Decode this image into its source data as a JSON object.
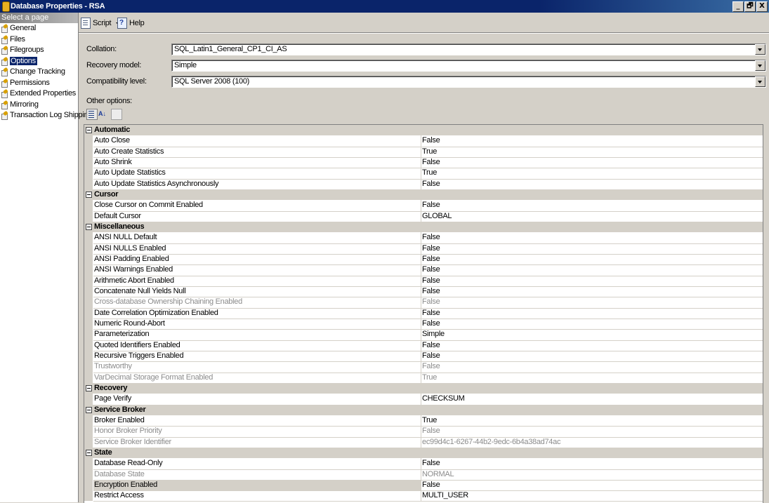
{
  "window": {
    "title": "Database Properties - RSA",
    "buttons": {
      "minimize": "_",
      "restore": "🗗",
      "close": "X"
    }
  },
  "left_pane": {
    "header": "Select a page",
    "items": [
      {
        "label": "General",
        "selected": false
      },
      {
        "label": "Files",
        "selected": false
      },
      {
        "label": "Filegroups",
        "selected": false
      },
      {
        "label": "Options",
        "selected": true
      },
      {
        "label": "Change Tracking",
        "selected": false
      },
      {
        "label": "Permissions",
        "selected": false
      },
      {
        "label": "Extended Properties",
        "selected": false
      },
      {
        "label": "Mirroring",
        "selected": false
      },
      {
        "label": "Transaction Log Shipping",
        "selected": false
      }
    ]
  },
  "toolbar": {
    "script_label": "Script",
    "help_label": "Help"
  },
  "fields": {
    "collation": {
      "label": "Collation:",
      "value": "SQL_Latin1_General_CP1_CI_AS"
    },
    "recovery_model": {
      "label": "Recovery model:",
      "value": "Simple"
    },
    "compatibility_level": {
      "label": "Compatibility level:",
      "value": "SQL Server 2008 (100)"
    }
  },
  "other_options_label": "Other options:",
  "property_grid": [
    {
      "category": "Automatic",
      "rows": [
        {
          "name": "Auto Close",
          "value": "False"
        },
        {
          "name": "Auto Create Statistics",
          "value": "True"
        },
        {
          "name": "Auto Shrink",
          "value": "False"
        },
        {
          "name": "Auto Update Statistics",
          "value": "True"
        },
        {
          "name": "Auto Update Statistics Asynchronously",
          "value": "False"
        }
      ]
    },
    {
      "category": "Cursor",
      "rows": [
        {
          "name": "Close Cursor on Commit Enabled",
          "value": "False"
        },
        {
          "name": "Default Cursor",
          "value": "GLOBAL"
        }
      ]
    },
    {
      "category": "Miscellaneous",
      "rows": [
        {
          "name": "ANSI NULL Default",
          "value": "False"
        },
        {
          "name": "ANSI NULLS Enabled",
          "value": "False"
        },
        {
          "name": "ANSI Padding Enabled",
          "value": "False"
        },
        {
          "name": "ANSI Warnings Enabled",
          "value": "False"
        },
        {
          "name": "Arithmetic Abort Enabled",
          "value": "False"
        },
        {
          "name": "Concatenate Null Yields Null",
          "value": "False"
        },
        {
          "name": "Cross-database Ownership Chaining Enabled",
          "value": "False",
          "disabled": true
        },
        {
          "name": "Date Correlation Optimization Enabled",
          "value": "False"
        },
        {
          "name": "Numeric Round-Abort",
          "value": "False"
        },
        {
          "name": "Parameterization",
          "value": "Simple"
        },
        {
          "name": "Quoted Identifiers Enabled",
          "value": "False"
        },
        {
          "name": "Recursive Triggers Enabled",
          "value": "False"
        },
        {
          "name": "Trustworthy",
          "value": "False",
          "disabled": true
        },
        {
          "name": "VarDecimal Storage Format Enabled",
          "value": "True",
          "disabled": true
        }
      ]
    },
    {
      "category": "Recovery",
      "rows": [
        {
          "name": "Page Verify",
          "value": "CHECKSUM"
        }
      ]
    },
    {
      "category": "Service Broker",
      "rows": [
        {
          "name": "Broker Enabled",
          "value": "True"
        },
        {
          "name": "Honor Broker Priority",
          "value": "False",
          "disabled": true
        },
        {
          "name": "Service Broker Identifier",
          "value": "ec99d4c1-6267-44b2-9edc-6b4a38ad74ac",
          "disabled": true
        }
      ]
    },
    {
      "category": "State",
      "rows": [
        {
          "name": "Database Read-Only",
          "value": "False"
        },
        {
          "name": "Database State",
          "value": "NORMAL",
          "disabled": true
        },
        {
          "name": "Encryption Enabled",
          "value": "False",
          "highlighted": true
        },
        {
          "name": "Restrict Access",
          "value": "MULTI_USER"
        }
      ]
    }
  ]
}
